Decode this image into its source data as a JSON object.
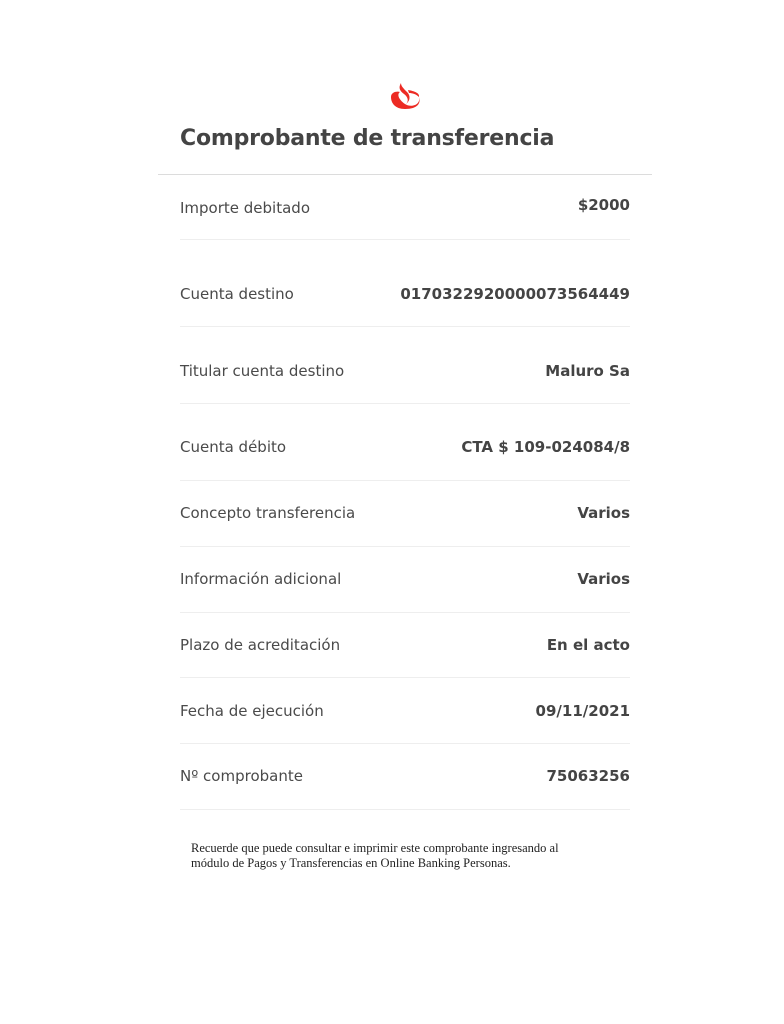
{
  "brand": {
    "logo_icon": "santander-flame-icon",
    "accent_color": "#ec2b24"
  },
  "header": {
    "title": "Comprobante de transferencia"
  },
  "details": [
    {
      "label": "Importe debitado",
      "value": "$2000"
    },
    {
      "label": "Cuenta destino",
      "value": "0170322920000073564449"
    },
    {
      "label": "Titular cuenta destino",
      "value": "Maluro Sa"
    },
    {
      "label": "Cuenta débito",
      "value": "CTA $ 109-024084/8"
    },
    {
      "label": "Concepto transferencia",
      "value": "Varios"
    },
    {
      "label": "Información adicional",
      "value": "Varios"
    },
    {
      "label": "Plazo de acreditación",
      "value": "En el acto"
    },
    {
      "label": "Fecha de ejecución",
      "value": "09/11/2021"
    },
    {
      "label": "Nº comprobante",
      "value": "75063256"
    }
  ],
  "footer": {
    "note_line_1": "Recuerde que puede consultar e imprimir este comprobante ingresando al",
    "note_line_2": "módulo de Pagos y Transferencias en Online Banking Personas."
  }
}
